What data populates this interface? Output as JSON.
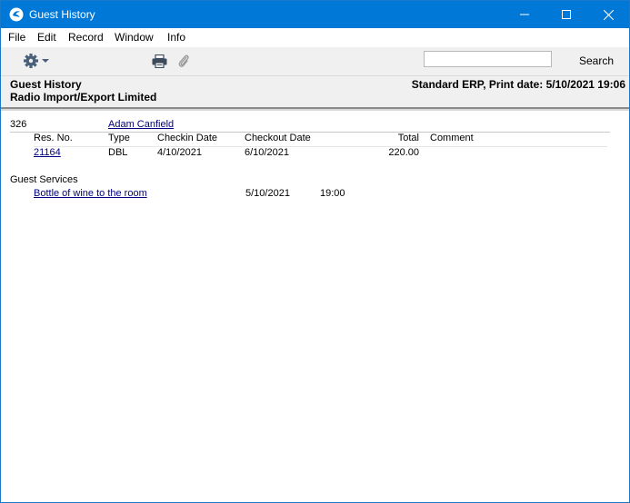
{
  "window": {
    "title": "Guest History",
    "controls": [
      "minimize-icon",
      "maximize-icon",
      "close-icon"
    ]
  },
  "menu": {
    "items": [
      "File",
      "Edit",
      "Record",
      "Window",
      "Info"
    ]
  },
  "toolbar": {
    "icons": [
      "gear-icon",
      "print-icon",
      "paperclip-icon"
    ],
    "search_value": "",
    "search_label": "Search"
  },
  "report_header": {
    "title": "Guest History",
    "company": "Radio Import/Export Limited",
    "right_info": "Standard ERP, Print date: 5/10/2021 19:06"
  },
  "guest": {
    "number": "326",
    "name": "Adam Canfield",
    "columns": {
      "res_no": "Res. No.",
      "type": "Type",
      "checkin": "Checkin Date",
      "checkout": "Checkout Date",
      "total": "Total",
      "comment": "Comment"
    },
    "reservations": [
      {
        "res_no": "21164",
        "type": "DBL",
        "checkin": "4/10/2021",
        "checkout": "6/10/2021",
        "total": "220.00",
        "comment": ""
      }
    ]
  },
  "services": {
    "heading": "Guest Services",
    "items": [
      {
        "description": "Bottle of wine to the room",
        "date": "5/10/2021",
        "time": "19:00"
      }
    ]
  }
}
